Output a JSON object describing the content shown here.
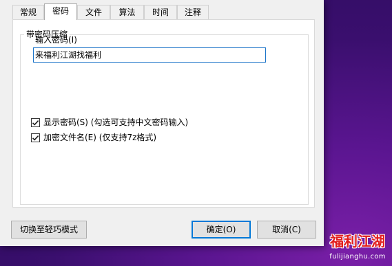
{
  "tabs": [
    {
      "label": "常规",
      "active": false
    },
    {
      "label": "密码",
      "active": true
    },
    {
      "label": "文件",
      "active": false
    },
    {
      "label": "算法",
      "active": false
    },
    {
      "label": "时间",
      "active": false
    },
    {
      "label": "注释",
      "active": false
    }
  ],
  "group": {
    "legend": "带密码压缩"
  },
  "password": {
    "label": "输入密码(I)",
    "value": "来福利江湖找福利"
  },
  "options": [
    {
      "label": "显示密码(S) (勾选可支持中文密码输入)",
      "checked": true
    },
    {
      "label": "加密文件名(E) (仅支持7z格式)",
      "checked": true
    }
  ],
  "buttons": {
    "switch_mode": "切换至轻巧模式",
    "ok": "确定(O)",
    "cancel": "取消(C)"
  },
  "watermark": {
    "title": "福利江湖",
    "url": "fulijianghu.com"
  },
  "colors": {
    "focus_border": "#1a73c8",
    "primary_border": "#0078d7",
    "watermark_red": "#e11d1d"
  }
}
